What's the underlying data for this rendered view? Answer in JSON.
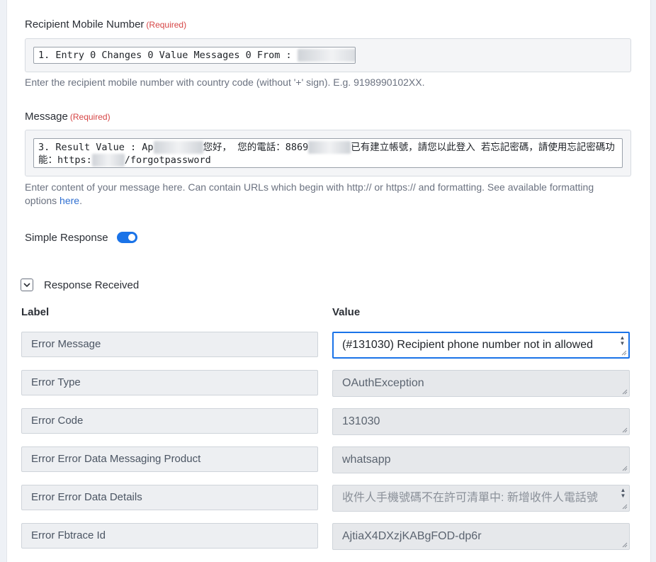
{
  "recipient": {
    "label": "Recipient Mobile Number",
    "required": "(Required)",
    "token_prefix": "1. Entry 0 Changes 0 Value Messages 0 From : ",
    "token_masked": "886931270497",
    "help": "Enter the recipient mobile number with country code (without '+' sign). E.g. 9198990102XX."
  },
  "message": {
    "label": "Message",
    "required": "(Required)",
    "line1_a": "3. Result Value : Ap",
    "line1_b": "您好， 您的電話：8869",
    "line1_c": "已有建立帳號，請您以此登入 若忘記密碼，請使用忘記密碼功",
    "line2_a": "能：https:",
    "line2_b": "/forgotpassword",
    "help": "Enter content of your message here. Can contain URLs which begin with http:// or https:// and formatting. See available formatting options ",
    "help_link": "here",
    "help_end": "."
  },
  "simple_response": {
    "label": "Simple Response",
    "enabled": true
  },
  "response": {
    "title": "Response Received",
    "expanded": true,
    "col_label": "Label",
    "col_value": "Value",
    "rows": [
      {
        "label": "Error Message",
        "value": "(#131030) Recipient phone number not in allowed"
      },
      {
        "label": "Error Type",
        "value": "OAuthException"
      },
      {
        "label": "Error Code",
        "value": "131030"
      },
      {
        "label": "Error Error Data Messaging Product",
        "value": "whatsapp"
      },
      {
        "label": "Error Error Data Details",
        "value": "收件人手機號碼不在許可清單中: 新增收件人電話號"
      },
      {
        "label": "Error Fbtrace Id",
        "value": "AjtiaX4DXzjKABgFOD-dp6r"
      }
    ]
  },
  "colors": {
    "accent": "#1a73e8",
    "required": "#d64545",
    "link": "#2f6fd1"
  }
}
